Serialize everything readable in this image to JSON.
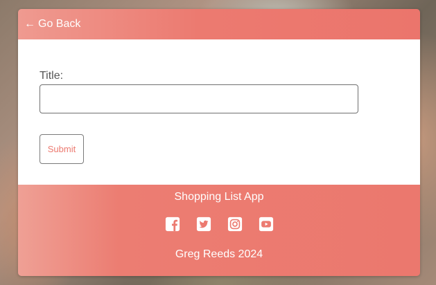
{
  "header": {
    "back_arrow": "←",
    "back_label": "Go Back"
  },
  "form": {
    "title_label": "Title:",
    "title_value": "",
    "title_placeholder": "",
    "submit_label": "Submit"
  },
  "footer": {
    "app_name": "Shopping List App",
    "credit": "Greg Reeds 2024",
    "social_icons": [
      "facebook-icon",
      "twitter-icon",
      "instagram-icon",
      "youtube-icon"
    ]
  },
  "colors": {
    "accent": "#ec7a70",
    "accent_light": "#efa095",
    "text_muted": "#555555"
  }
}
